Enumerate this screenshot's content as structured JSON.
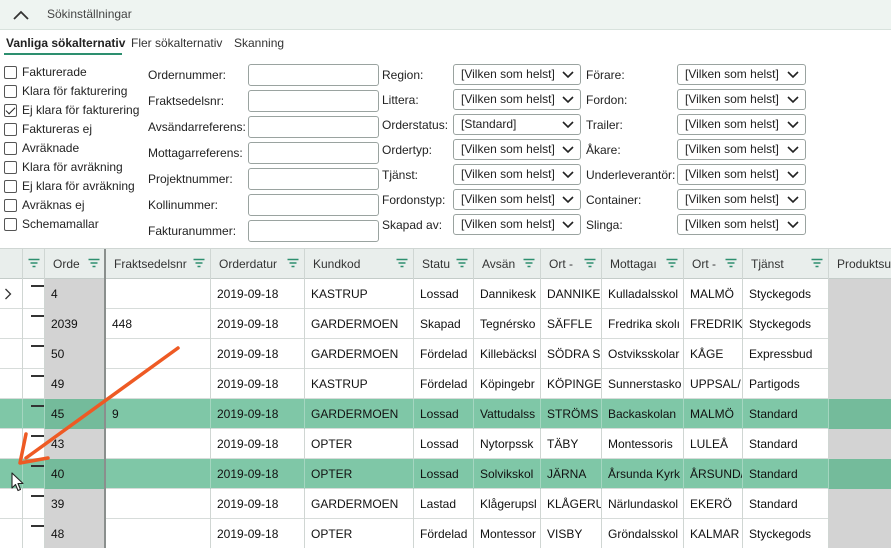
{
  "header": {
    "title": "Sökinställningar"
  },
  "tabs": [
    {
      "label": "Vanliga sökalternativ",
      "active": true
    },
    {
      "label": "Fler sökalternativ",
      "active": false
    },
    {
      "label": "Skanning",
      "active": false
    }
  ],
  "checkboxes": [
    {
      "label": "Fakturerade",
      "checked": false
    },
    {
      "label": "Klara för fakturering",
      "checked": false
    },
    {
      "label": "Ej klara för fakturering",
      "checked": true
    },
    {
      "label": "Faktureras ej",
      "checked": false
    },
    {
      "label": "Avräknade",
      "checked": false
    },
    {
      "label": "Klara för avräkning",
      "checked": false
    },
    {
      "label": "Ej klara för avräkning",
      "checked": false
    },
    {
      "label": "Avräknas ej",
      "checked": false
    },
    {
      "label": "Schemamallar",
      "checked": false
    }
  ],
  "text_fields": [
    {
      "label": "Ordernummer:",
      "value": ""
    },
    {
      "label": "Fraktsedelsnr:",
      "value": ""
    },
    {
      "label": "Avsändarreferens:",
      "value": ""
    },
    {
      "label": "Mottagarreferens:",
      "value": ""
    },
    {
      "label": "Projektnummer:",
      "value": ""
    },
    {
      "label": "Kollinummer:",
      "value": ""
    },
    {
      "label": "Fakturanummer:",
      "value": ""
    }
  ],
  "selects_col1": [
    {
      "label": "Region:",
      "value": "[Vilken som helst]"
    },
    {
      "label": "Littera:",
      "value": "[Vilken som helst]"
    },
    {
      "label": "Orderstatus:",
      "value": "[Standard]"
    },
    {
      "label": "Ordertyp:",
      "value": "[Vilken som helst]"
    },
    {
      "label": "Tjänst:",
      "value": "[Vilken som helst]"
    },
    {
      "label": "Fordonstyp:",
      "value": "[Vilken som helst]"
    },
    {
      "label": "Skapad av:",
      "value": "[Vilken som helst]"
    }
  ],
  "selects_col2": [
    {
      "label": "Förare:",
      "value": "[Vilken som helst]"
    },
    {
      "label": "Fordon:",
      "value": "[Vilken som helst]"
    },
    {
      "label": "Trailer:",
      "value": "[Vilken som helst]"
    },
    {
      "label": "Åkare:",
      "value": "[Vilken som helst]"
    },
    {
      "label": "Underleverantör:",
      "value": "[Vilken som helst]"
    },
    {
      "label": "Container:",
      "value": "[Vilken som helst]"
    },
    {
      "label": "Slinga:",
      "value": "[Vilken som helst]"
    }
  ],
  "grid": {
    "columns": [
      "Orde",
      "Fraktsedelsnr",
      "Orderdatur",
      "Kundkod",
      "Statu",
      "Avsän",
      "Ort -",
      "Mottagaı",
      "Ort -",
      "Tjänst",
      "Produktsur"
    ],
    "rows": [
      {
        "cells": [
          "4",
          "",
          "2019-09-18",
          "KASTRUP",
          "Lossad",
          "Dannikesk",
          "DANNIKE",
          "Kulladalsskol",
          "MALMÖ",
          "Styckegods",
          ""
        ],
        "highlight": false,
        "current": true
      },
      {
        "cells": [
          "2039",
          "448",
          "2019-09-18",
          "GARDERMOEN",
          "Skapad",
          "Tegnérsko",
          "SÄFFLE",
          "Fredrika skolı",
          "FREDRIK.",
          "Styckegods",
          ""
        ],
        "highlight": false,
        "current": false
      },
      {
        "cells": [
          "50",
          "",
          "2019-09-18",
          "GARDERMOEN",
          "Fördelad",
          "Killebäcksl",
          "SÖDRA S",
          "Ostviksskolar",
          "KÅGE",
          "Expressbud",
          ""
        ],
        "highlight": false,
        "current": false
      },
      {
        "cells": [
          "49",
          "",
          "2019-09-18",
          "KASTRUP",
          "Fördelad",
          "Köpingebr",
          "KÖPINGE",
          "Sunnerstasko",
          "UPPSAL/",
          "Partigods",
          ""
        ],
        "highlight": false,
        "current": false
      },
      {
        "cells": [
          "45",
          "9",
          "2019-09-18",
          "GARDERMOEN",
          "Lossad",
          "Vattudalss",
          "STRÖMS",
          "Backaskolan",
          "MALMÖ",
          "Standard",
          ""
        ],
        "highlight": true,
        "current": false
      },
      {
        "cells": [
          "43",
          "",
          "2019-09-18",
          "OPTER",
          "Lossad",
          "Nytorpssk",
          "TÄBY",
          "Montessoris",
          "LULEÅ",
          "Standard",
          ""
        ],
        "highlight": false,
        "current": false
      },
      {
        "cells": [
          "40",
          "",
          "2019-09-18",
          "OPTER",
          "Lossad",
          "Solvikskol",
          "JÄRNA",
          "Årsunda Kyrk",
          "ÅRSUND/",
          "Standard",
          ""
        ],
        "highlight": true,
        "current": false
      },
      {
        "cells": [
          "39",
          "",
          "2019-09-18",
          "GARDERMOEN",
          "Lastad",
          "Klågerupsl",
          "KLÅGERU",
          "Närlundaskol",
          "EKERÖ",
          "Standard",
          ""
        ],
        "highlight": false,
        "current": false
      },
      {
        "cells": [
          "48",
          "",
          "2019-09-18",
          "OPTER",
          "Fördelad",
          "Montessor",
          "VISBY",
          "Gröndalsskol",
          "KALMAR",
          "Styckegods",
          ""
        ],
        "highlight": false,
        "current": false
      }
    ]
  },
  "colors": {
    "accent": "#2d8f6f",
    "row_highlight": "#7fc7a7",
    "annotation_arrow": "#ee5a24"
  },
  "icons": [
    "chevron-up-icon",
    "chevron-down-icon",
    "filter-icon",
    "row-pointer-icon",
    "mouse-cursor-icon",
    "annotation-arrow"
  ]
}
